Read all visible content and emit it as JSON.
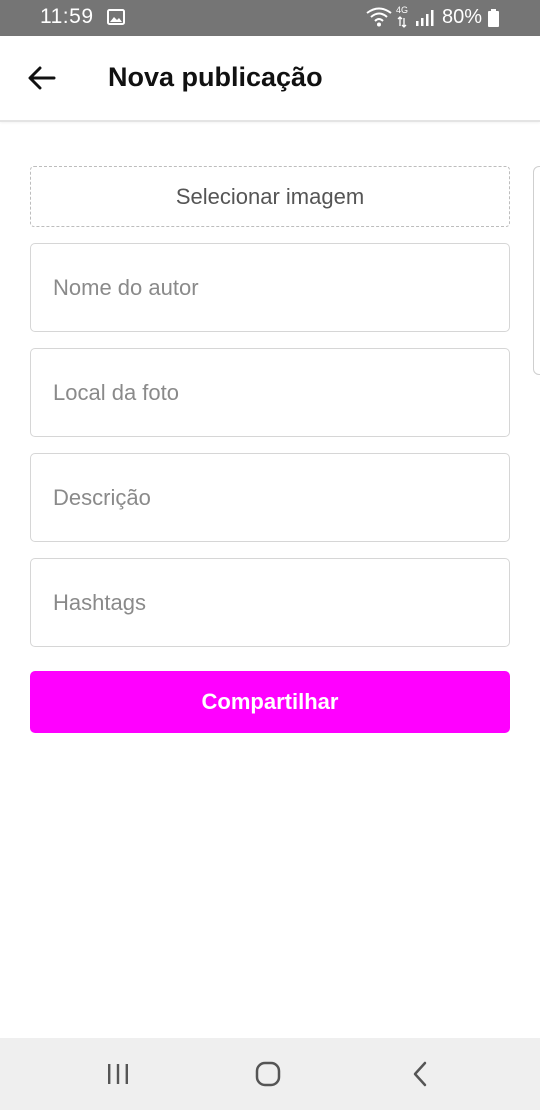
{
  "status_bar": {
    "time": "11:59",
    "network": "4G",
    "battery": "80%",
    "icons": [
      "image-icon",
      "wifi-icon",
      "signal-icon",
      "battery-icon"
    ]
  },
  "app_bar": {
    "title": "Nova publicação",
    "back_icon": "arrow-left-icon"
  },
  "form": {
    "image_picker_label": "Selecionar imagem",
    "author_placeholder": "Nome do autor",
    "location_placeholder": "Local da foto",
    "description_placeholder": "Descrição",
    "hashtags_placeholder": "Hashtags",
    "submit_label": "Compartilhar"
  },
  "nav_bar": {
    "icons": [
      "recent-apps-icon",
      "home-icon",
      "back-chevron-icon"
    ]
  },
  "colors": {
    "accent": "#ff00ff",
    "status_bar_bg": "#757575",
    "nav_bar_bg": "#efefef",
    "border": "#d6d6d6",
    "placeholder": "#8a8a8a"
  }
}
